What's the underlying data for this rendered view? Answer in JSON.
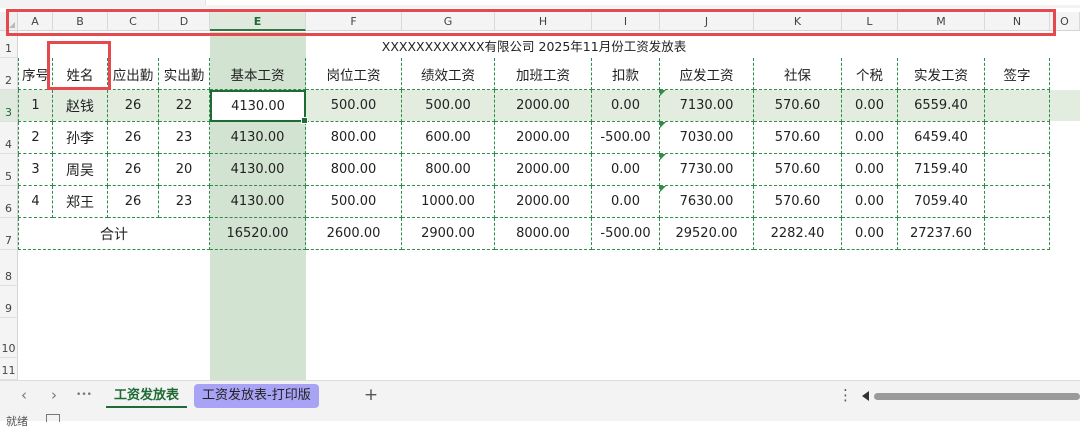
{
  "columns": [
    "A",
    "B",
    "C",
    "D",
    "E",
    "F",
    "G",
    "H",
    "I",
    "J",
    "K",
    "L",
    "M",
    "N",
    "O"
  ],
  "rows": [
    "1",
    "2",
    "3",
    "4",
    "5",
    "6",
    "7",
    "8",
    "9",
    "10",
    "11"
  ],
  "title": "XXXXXXXXXXXX有限公司 2025年11月份工资发放表",
  "headers": [
    "序号",
    "姓名",
    "应出勤",
    "实出勤",
    "基本工资",
    "岗位工资",
    "绩效工资",
    "加班工资",
    "扣款",
    "应发工资",
    "社保",
    "个税",
    "实发工资",
    "签字"
  ],
  "records": [
    [
      "1",
      "赵钱",
      "26",
      "22",
      "4130.00",
      "500.00",
      "500.00",
      "2000.00",
      "0.00",
      "7130.00",
      "570.60",
      "0.00",
      "6559.40",
      ""
    ],
    [
      "2",
      "孙李",
      "26",
      "23",
      "4130.00",
      "800.00",
      "600.00",
      "2000.00",
      "-500.00",
      "7030.00",
      "570.60",
      "0.00",
      "6459.40",
      ""
    ],
    [
      "3",
      "周吴",
      "26",
      "20",
      "4130.00",
      "800.00",
      "800.00",
      "2000.00",
      "0.00",
      "7730.00",
      "570.60",
      "0.00",
      "7159.40",
      ""
    ],
    [
      "4",
      "郑王",
      "26",
      "23",
      "4130.00",
      "500.00",
      "1000.00",
      "2000.00",
      "0.00",
      "7630.00",
      "570.60",
      "0.00",
      "7059.40",
      ""
    ]
  ],
  "total": {
    "label": "合计",
    "values": [
      "16520.00",
      "2600.00",
      "2900.00",
      "8000.00",
      "-500.00",
      "29520.00",
      "2282.40",
      "0.00",
      "27237.60",
      ""
    ]
  },
  "sheet_tabs": {
    "active": "工资发放表",
    "other": "工资发放表-打印版"
  },
  "nav": {
    "prev": "‹",
    "next": "›",
    "more": "•••",
    "add": "+",
    "options": "⋮"
  },
  "status_bar": {
    "text": "就绪"
  },
  "colors": {
    "accent": "#1e6b34",
    "highlight_box": "#e5484d",
    "selected_column": "#d3e3d2",
    "print_tab": "#a9a3f5"
  }
}
